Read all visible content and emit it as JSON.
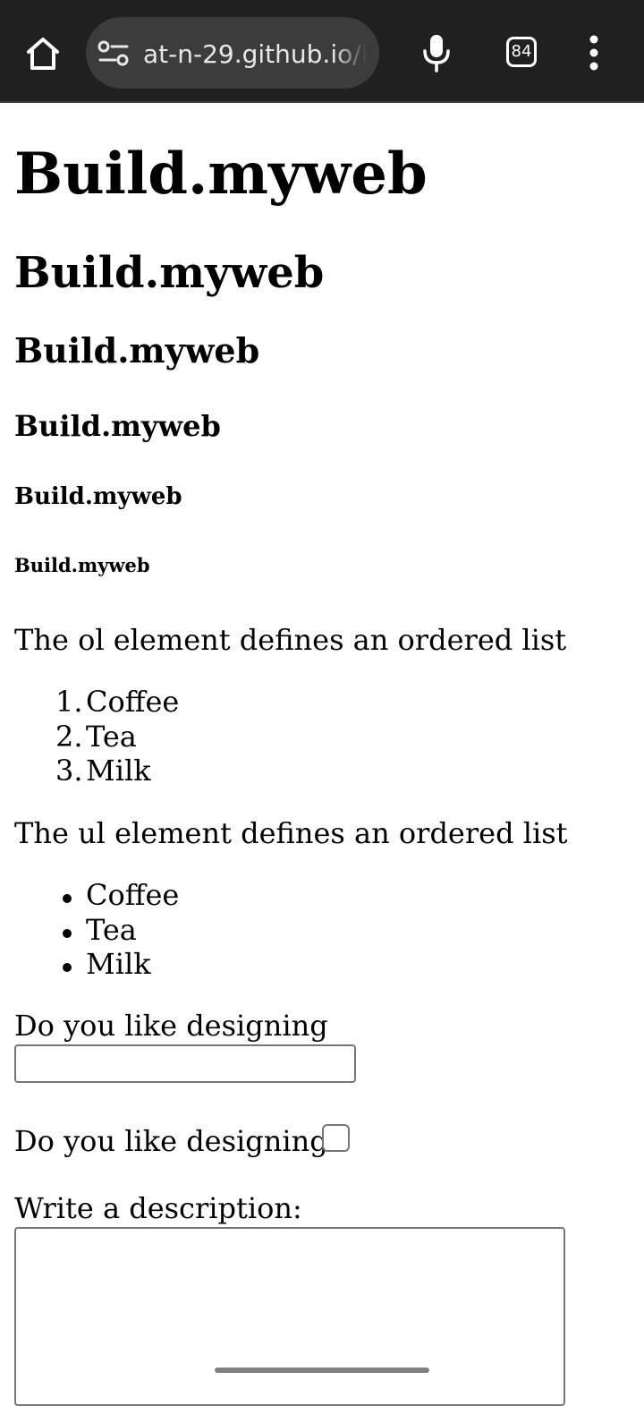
{
  "browser": {
    "url": "at-n-29.github.io/L",
    "tab_count": "84",
    "icons": [
      "home-icon",
      "site-settings-icon",
      "microphone-icon",
      "tab-switcher-icon",
      "more-vert-icon"
    ]
  },
  "page": {
    "headings": {
      "h1": "Build.myweb",
      "h2": "Build.myweb",
      "h3": "Build.myweb",
      "h4": "Build.myweb",
      "h5": "Build.myweb",
      "h6": "Build.myweb"
    },
    "ol_intro": "The ol element defines an ordered list",
    "ordered_list": [
      {
        "marker": "1.",
        "text": "Coffee"
      },
      {
        "marker": "2.",
        "text": "Tea"
      },
      {
        "marker": "3.",
        "text": "Milk"
      }
    ],
    "ul_intro": "The ul element defines an ordered list",
    "unordered_list": [
      "Coffee",
      "Tea",
      "Milk"
    ],
    "form": {
      "text_label": "Do you like designing",
      "text_value": "",
      "checkbox_label": "Do you like designing",
      "checkbox_checked": false,
      "textarea_label": "Write a description:",
      "textarea_value": ""
    }
  },
  "colors": {
    "chrome_bg": "#202020",
    "omnibox_bg": "#3c3c3c",
    "field_border": "#767676"
  }
}
